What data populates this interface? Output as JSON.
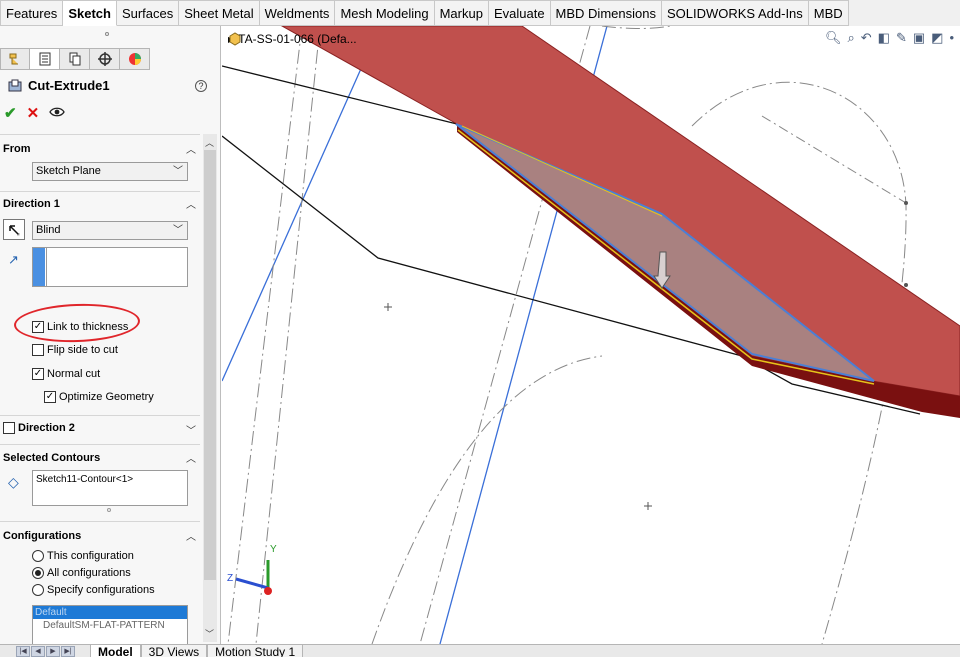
{
  "tabs": [
    "Features",
    "Sketch",
    "Surfaces",
    "Sheet Metal",
    "Weldments",
    "Mesh Modeling",
    "Markup",
    "Evaluate",
    "MBD Dimensions",
    "SOLIDWORKS Add-Ins",
    "MBD"
  ],
  "active_tab": "Sketch",
  "property_manager": {
    "title": "Cut-Extrude1",
    "help": "?",
    "from": {
      "label": "From",
      "value": "Sketch Plane"
    },
    "direction1": {
      "label": "Direction 1",
      "end_condition": "Blind",
      "depth_value": "",
      "link_to_thickness": "Link to thickness",
      "flip_side": "Flip side to cut",
      "normal_cut": "Normal cut",
      "optimize_geometry": "Optimize Geometry"
    },
    "direction2": {
      "label": "Direction 2"
    },
    "selected_contours": {
      "label": "Selected Contours",
      "value": "Sketch11-Contour<1>"
    },
    "configurations": {
      "label": "Configurations",
      "options": [
        "This configuration",
        "All configurations",
        "Specify configurations"
      ],
      "list": [
        "Default",
        "DefaultSM-FLAT-PATTERN"
      ]
    }
  },
  "graphics": {
    "tree_label": "TA-SS-01-066 (Defa...",
    "triad": {
      "y": "Y",
      "z": "Z"
    }
  },
  "bottom_tabs": [
    "Model",
    "3D Views",
    "Motion Study 1"
  ],
  "colors": {
    "part_red": "#c0504d",
    "part_dark": "#7a1010",
    "selection_blue": "#4a7fd6",
    "annotation_red": "#e0262b"
  }
}
